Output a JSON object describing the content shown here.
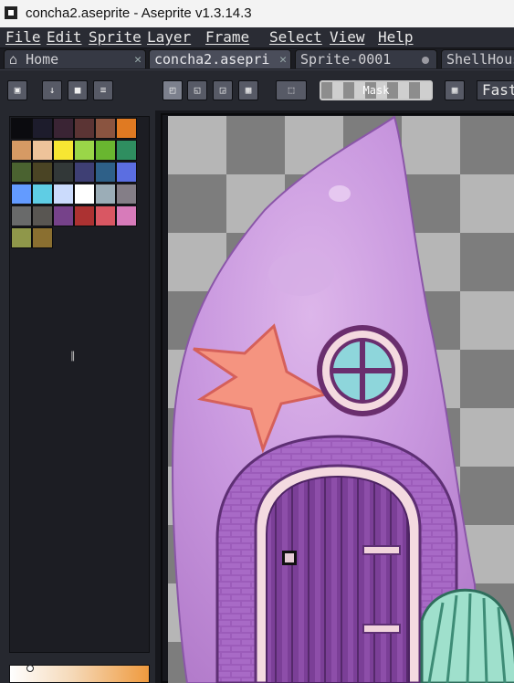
{
  "window": {
    "title": "concha2.aseprite - Aseprite v1.3.14.3"
  },
  "menu": [
    "File",
    "Edit",
    "Sprite",
    "Layer",
    "Frame",
    "Select",
    "View",
    "Help"
  ],
  "tabs": [
    {
      "label": "Home"
    },
    {
      "label": "concha2.asepri"
    },
    {
      "label": "Sprite-0001"
    },
    {
      "label": "ShellHous"
    }
  ],
  "toolbar": {
    "mask_label": "Mask",
    "fast_label": "Fast"
  },
  "palette": {
    "more_label": "∥",
    "colors": [
      "#0b0b0f",
      "#1d1c2c",
      "#3a2434",
      "#5b3434",
      "#8a5440",
      "#e07a22",
      "#d69a64",
      "#eec39a",
      "#f7e632",
      "#9ad648",
      "#69b630",
      "#2f8e60",
      "#4a6230",
      "#4a4424",
      "#323838",
      "#3e3f74",
      "#2e6088",
      "#5b6ee1",
      "#639bff",
      "#5fcde4",
      "#cbdbfc",
      "#ffffff",
      "#9badb7",
      "#847e87",
      "#696a6a",
      "#595652",
      "#76428a",
      "#ac3232",
      "#d95763",
      "#d77bba",
      "#8f974a",
      "#8a6f30"
    ]
  }
}
